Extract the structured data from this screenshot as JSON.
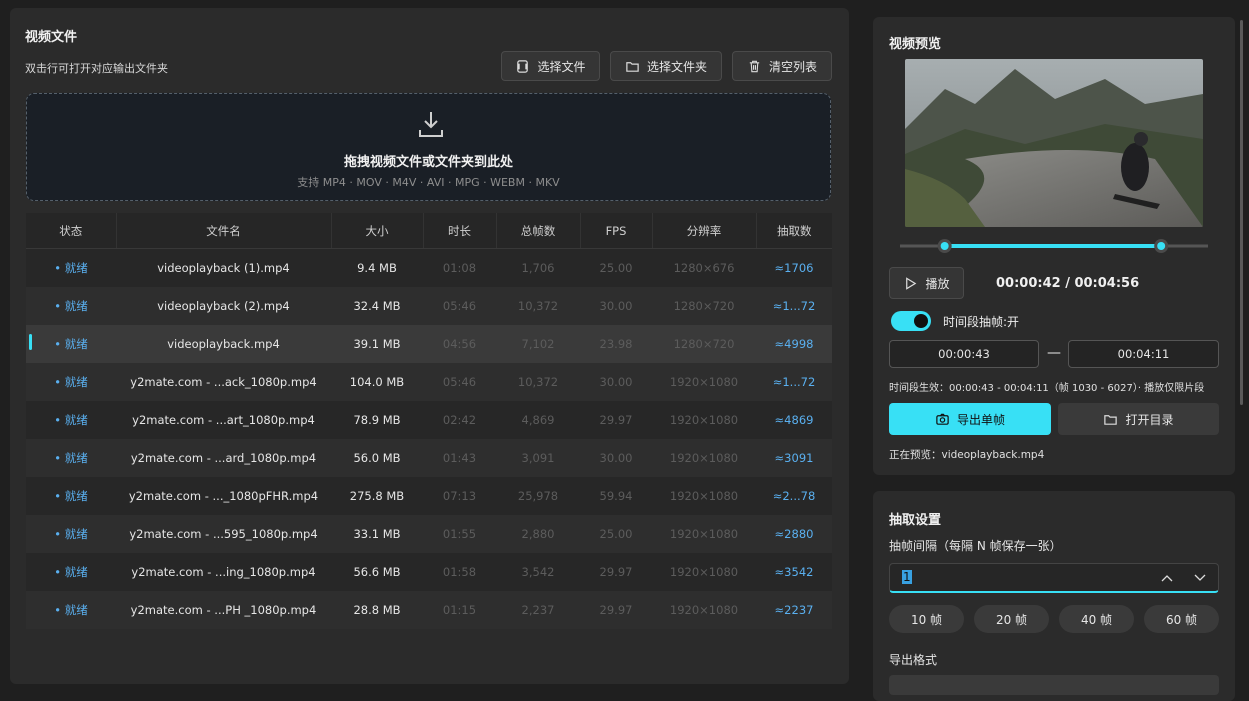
{
  "left": {
    "title": "视频文件",
    "hint": "双击行可打开对应输出文件夹",
    "buttons": {
      "select_file": "选择文件",
      "select_folder": "选择文件夹",
      "clear_list": "清空列表"
    },
    "drop": {
      "title": "拖拽视频文件或文件夹到此处",
      "formats": "支持 MP4 · MOV · M4V · AVI · MPG · WEBM · MKV"
    },
    "columns": [
      "状态",
      "文件名",
      "大小",
      "时长",
      "总帧数",
      "FPS",
      "分辨率",
      "抽取数"
    ],
    "rows": [
      {
        "status": "• 就绪",
        "name": "videoplayback (1).mp4",
        "size": "9.4 MB",
        "duration": "01:08",
        "frames": "1,706",
        "fps": "25.00",
        "res": "1280×676",
        "extract": "≈1706"
      },
      {
        "status": "• 就绪",
        "name": "videoplayback (2).mp4",
        "size": "32.4 MB",
        "duration": "05:46",
        "frames": "10,372",
        "fps": "30.00",
        "res": "1280×720",
        "extract": "≈1...72"
      },
      {
        "status": "• 就绪",
        "name": "videoplayback.mp4",
        "size": "39.1 MB",
        "duration": "04:56",
        "frames": "7,102",
        "fps": "23.98",
        "res": "1280×720",
        "extract": "≈4998"
      },
      {
        "status": "• 就绪",
        "name": "y2mate.com - ...ack_1080p.mp4",
        "size": "104.0 MB",
        "duration": "05:46",
        "frames": "10,372",
        "fps": "30.00",
        "res": "1920×1080",
        "extract": "≈1...72"
      },
      {
        "status": "• 就绪",
        "name": "y2mate.com - ...art_1080p.mp4",
        "size": "78.9 MB",
        "duration": "02:42",
        "frames": "4,869",
        "fps": "29.97",
        "res": "1920×1080",
        "extract": "≈4869"
      },
      {
        "status": "• 就绪",
        "name": "y2mate.com - ...ard_1080p.mp4",
        "size": "56.0 MB",
        "duration": "01:43",
        "frames": "3,091",
        "fps": "30.00",
        "res": "1920×1080",
        "extract": "≈3091"
      },
      {
        "status": "• 就绪",
        "name": "y2mate.com - ..._1080pFHR.mp4",
        "size": "275.8 MB",
        "duration": "07:13",
        "frames": "25,978",
        "fps": "59.94",
        "res": "1920×1080",
        "extract": "≈2...78"
      },
      {
        "status": "• 就绪",
        "name": "y2mate.com - ...595_1080p.mp4",
        "size": "33.1 MB",
        "duration": "01:55",
        "frames": "2,880",
        "fps": "25.00",
        "res": "1920×1080",
        "extract": "≈2880"
      },
      {
        "status": "• 就绪",
        "name": "y2mate.com - ...ing_1080p.mp4",
        "size": "56.6 MB",
        "duration": "01:58",
        "frames": "3,542",
        "fps": "29.97",
        "res": "1920×1080",
        "extract": "≈3542"
      },
      {
        "status": "• 就绪",
        "name": "y2mate.com - ...PH _1080p.mp4",
        "size": "28.8 MB",
        "duration": "01:15",
        "frames": "2,237",
        "fps": "29.97",
        "res": "1920×1080",
        "extract": "≈2237"
      }
    ],
    "selected_row": 2
  },
  "preview": {
    "title": "视频预览",
    "play_label": "播放",
    "time": "00:00:42 / 00:04:56",
    "toggle_label": "时间段抽帧:开",
    "toggle_on": true,
    "start": "00:00:43",
    "end": "00:04:11",
    "dash": "—",
    "range_info": "时间段生效：00:00:43 - 00:04:11（帧 1030 - 6027）· 播放仅限片段",
    "export_frame": "导出单帧",
    "open_dir": "打开目录",
    "now_previewing": "正在预览：videoplayback.mp4",
    "range_start_fraction": 0.145,
    "range_end_fraction": 0.848,
    "accent": "#38e0f5"
  },
  "settings": {
    "title": "抽取设置",
    "interval_label": "抽帧间隔（每隔 N 帧保存一张）",
    "interval_value": "1",
    "presets": [
      "10 帧",
      "20 帧",
      "40 帧",
      "60 帧"
    ],
    "format_label": "导出格式"
  }
}
